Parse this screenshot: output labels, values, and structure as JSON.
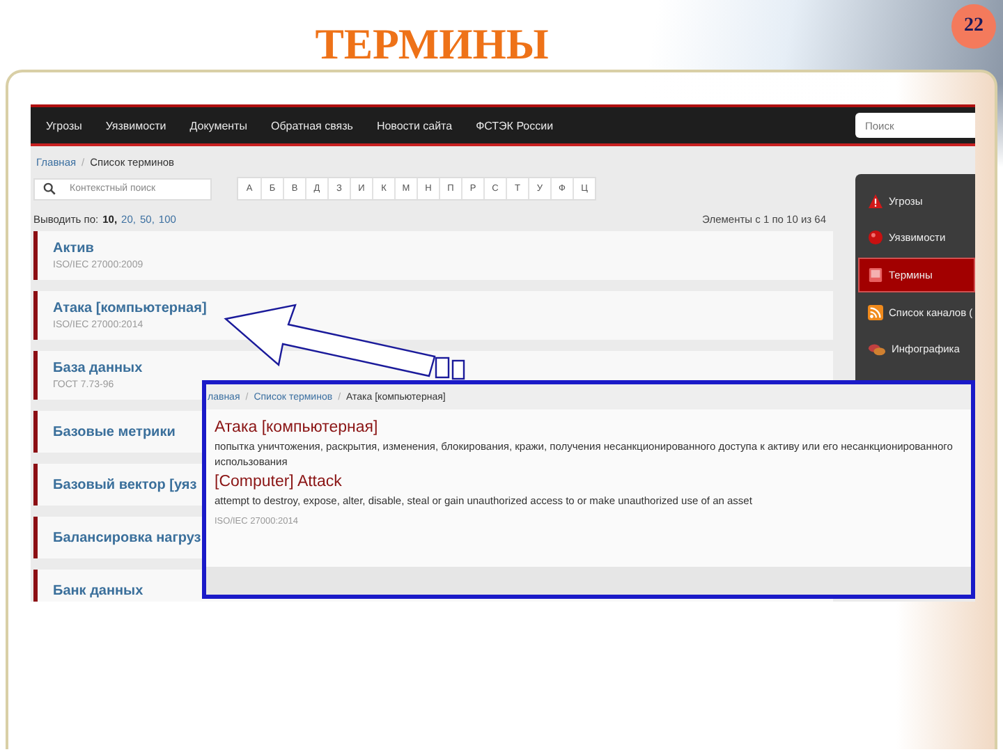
{
  "slide": {
    "title": "ТЕРМИНЫ",
    "page_number": "22"
  },
  "nav": {
    "items": [
      "Угрозы",
      "Уязвимости",
      "Документы",
      "Обратная связь",
      "Новости сайта",
      "ФСТЭК России"
    ],
    "search": {
      "placeholder": "Поиск"
    }
  },
  "breadcrumb": {
    "separator": "/",
    "items": [
      {
        "label": "Главная",
        "link": true
      },
      {
        "label": "Список терминов",
        "link": false
      }
    ]
  },
  "search": {
    "placeholder": "Контекстный поиск"
  },
  "alphabet": [
    "А",
    "Б",
    "В",
    "Д",
    "З",
    "И",
    "К",
    "М",
    "Н",
    "П",
    "Р",
    "С",
    "Т",
    "У",
    "Ф",
    "Ц"
  ],
  "page_size": {
    "label": "Выводить по:",
    "separator": ",",
    "options": [
      {
        "label": "10",
        "selected": true
      },
      {
        "label": "20",
        "selected": false
      },
      {
        "label": "50",
        "selected": false
      },
      {
        "label": "100",
        "selected": false
      }
    ]
  },
  "count": "Элементы с 1 по 10 из 64",
  "terms": [
    {
      "title": "Актив",
      "source": "ISO/IEC 27000:2009"
    },
    {
      "title": "Атака [компьютерная]",
      "source": "ISO/IEC 27000:2014"
    },
    {
      "title": "База данных",
      "source": "ГОСТ 7.73-96"
    },
    {
      "title": "Базовые метрики"
    },
    {
      "title": "Базовый вектор [уяз"
    },
    {
      "title": "Балансировка нагруз"
    },
    {
      "title": "Банк данных"
    }
  ],
  "sidebar": {
    "items": [
      {
        "label": "Угрозы",
        "kind": "warning",
        "selected": false
      },
      {
        "label": "Уязвимости",
        "kind": "sphere",
        "selected": false
      },
      {
        "label": "Термины",
        "kind": "book",
        "selected": true
      },
      {
        "label": "Список каналов (",
        "kind": "rss",
        "selected": false
      },
      {
        "label": "Инфографика",
        "kind": "pills",
        "selected": false
      }
    ]
  },
  "popup": {
    "breadcrumb": {
      "separator": "/",
      "items": [
        {
          "label": "лавная",
          "link": true
        },
        {
          "label": "Список терминов",
          "link": true
        },
        {
          "label": "Атака [компьютерная]",
          "link": false
        }
      ]
    },
    "title_ru": "Атака [компьютерная]",
    "text_ru": "попытка уничтожения, раскрытия, изменения, блокирования, кражи, получения несанкционированного доступа к активу или его несанкционированного использования",
    "title_en": "[Computer] Attack",
    "text_en": "attempt to destroy, expose, alter, disable, steal or gain unauthorized access to or make unauthorized use of an asset",
    "source": "ISO/IEC 27000:2014"
  }
}
